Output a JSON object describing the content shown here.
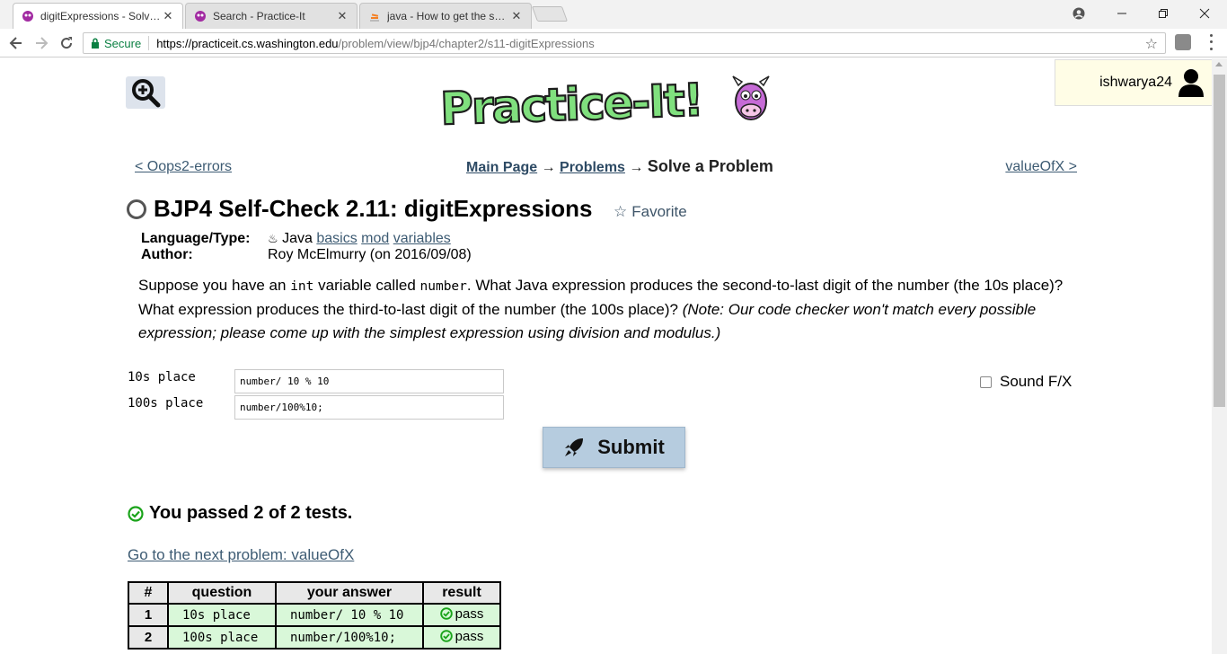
{
  "browser": {
    "tabs": [
      {
        "title": "digitExpressions - Solve a Problem",
        "active": true,
        "icon": "practiceit-icon"
      },
      {
        "title": "Search - Practice-It",
        "active": false,
        "icon": "practiceit-icon"
      },
      {
        "title": "java - How to get the separate digits",
        "active": false,
        "icon": "stackoverflow-icon"
      }
    ],
    "secure_label": "Secure",
    "url_host": "https://practiceit.cs.washington.edu",
    "url_path": "/problem/view/bjp4/chapter2/s11-digitExpressions"
  },
  "page": {
    "username": "ishwarya24",
    "prev_link": "< Oops2-errors",
    "next_link": "valueOfX >",
    "breadcrumb": {
      "main": "Main Page",
      "arrow1": " → ",
      "problems": "Problems",
      "arrow2": " → ",
      "current": "Solve a Problem"
    },
    "problem_title": "BJP4 Self-Check 2.11: digitExpressions",
    "favorite_label": "Favorite",
    "meta": {
      "lang_key": "Language/Type:",
      "lang_value": "Java",
      "tags": [
        "basics",
        "mod",
        "variables"
      ],
      "author_key": "Author:",
      "author_value": "Roy McElmurry (on 2016/09/08)"
    },
    "description": {
      "p1": "Suppose you have an ",
      "code1": "int",
      "p2": " variable called ",
      "code2": "number",
      "p3": ". What Java expression produces the second-to-last digit of the number (the 10s place)? What expression produces the third-to-last digit of the number (the 100s place)? ",
      "note": "(Note: Our code checker won't match every possible expression; please come up with the simplest expression using division and modulus.)"
    },
    "fields": [
      {
        "label": "10s place",
        "value": "number/ 10 % 10"
      },
      {
        "label": "100s place",
        "value": "number/100%10;"
      }
    ],
    "sound_label": "Sound F/X",
    "submit_label": "Submit",
    "passed_text": "You passed 2 of 2 tests.",
    "next_problem_link": "Go to the next problem: valueOfX",
    "results": {
      "headers": [
        "#",
        "question",
        "your answer",
        "result"
      ],
      "rows": [
        {
          "num": "1",
          "question": "10s place",
          "answer": "number/ 10 % 10",
          "result": "pass"
        },
        {
          "num": "2",
          "question": "100s place",
          "answer": "number/100%10;",
          "result": "pass"
        }
      ]
    }
  },
  "colors": {
    "link": "#3d5b73",
    "pass_green": "#1aa31a",
    "logo_green": "#7ee07e",
    "submit_bg": "#b6ccdf"
  }
}
